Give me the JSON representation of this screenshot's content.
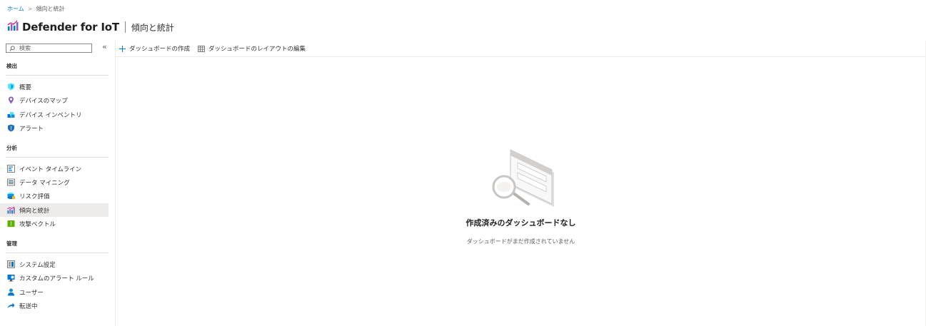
{
  "breadcrumb": {
    "home": "ホーム",
    "separator": ">",
    "current": "傾向と統計"
  },
  "header": {
    "app_title": "Defender for IoT",
    "page_title": "傾向と統計"
  },
  "sidebar": {
    "search_placeholder": "検索",
    "collapse_glyph": "«",
    "sections": [
      {
        "label": "検出",
        "items": [
          {
            "label": "概要",
            "icon": "shield-icon"
          },
          {
            "label": "デバイスのマップ",
            "icon": "map-pin-icon"
          },
          {
            "label": "デバイス インベントリ",
            "icon": "cubes-icon"
          },
          {
            "label": "アラート",
            "icon": "alert-shield-icon"
          }
        ]
      },
      {
        "label": "分析",
        "items": [
          {
            "label": "イベント タイムライン",
            "icon": "timeline-icon"
          },
          {
            "label": "データ マイニング",
            "icon": "data-mining-icon"
          },
          {
            "label": "リスク評価",
            "icon": "risk-assessment-icon"
          },
          {
            "label": "傾向と統計",
            "icon": "chart-icon",
            "active": true
          },
          {
            "label": "攻撃ベクトル",
            "icon": "attack-vector-icon"
          }
        ]
      },
      {
        "label": "管理",
        "items": [
          {
            "label": "システム設定",
            "icon": "system-settings-icon"
          },
          {
            "label": "カスタムのアラート ルール",
            "icon": "custom-rules-icon"
          },
          {
            "label": "ユーザー",
            "icon": "user-icon"
          },
          {
            "label": "転送中",
            "icon": "forwarding-icon"
          }
        ]
      }
    ]
  },
  "toolbar": {
    "create_label": "ダッシュボードの作成",
    "edit_layout_label": "ダッシュボードのレイアウトの編集"
  },
  "empty_state": {
    "title": "作成済みのダッシュボードなし",
    "description": "ダッシュボードがまだ作成されていません"
  },
  "colors": {
    "accent": "#0078d4",
    "active_bg": "#edebe9"
  }
}
